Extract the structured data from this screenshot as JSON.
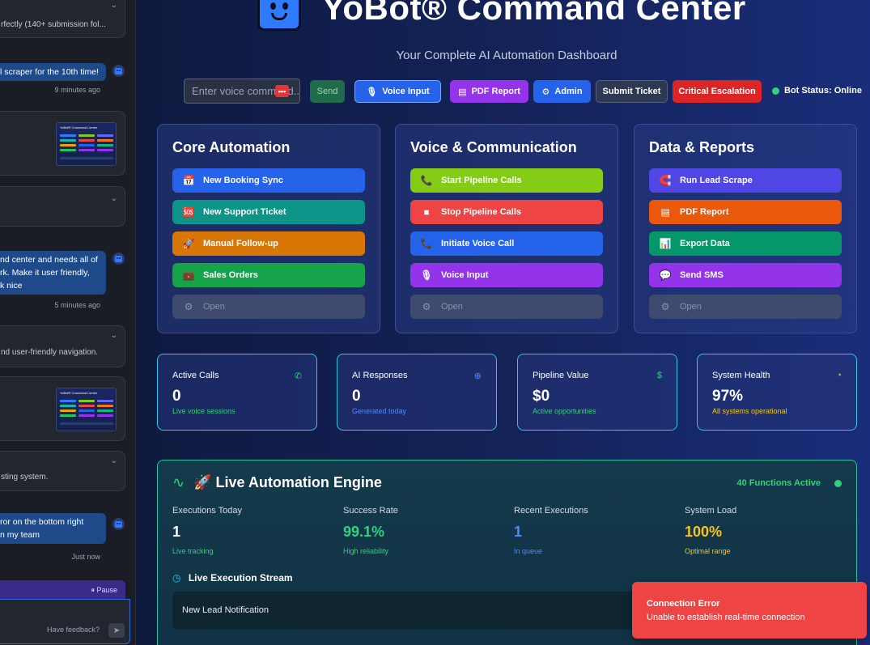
{
  "sidebar": {
    "card1_text": "rfectly (140+ submission fol...",
    "msg1": "l scraper for the 10th time!",
    "msg1_time": "9 minutes ago",
    "msg2_lines": [
      "nd center and needs all of",
      "rk. Make it user friendly,",
      "k nice"
    ],
    "msg2_time": "5 minutes ago",
    "card2_text": "nd user-friendly navigation.",
    "card3_text": "sting system.",
    "msg3_lines": [
      "ror on the bottom right",
      "n my team"
    ],
    "msg3_time": "Just now",
    "thumb_title": "YoBot® Command Center",
    "pause_label": "⏸ Pause",
    "feedback_placeholder": "Have feedback?"
  },
  "header": {
    "title": "YoBot® Command Center",
    "subtitle": "Your Complete AI Automation Dashboard"
  },
  "toolbar": {
    "voice_placeholder": "Enter voice command...",
    "badge": "•••",
    "send": "Send",
    "voice_input": "Voice Input",
    "pdf_report": "PDF Report",
    "admin": "Admin",
    "submit_ticket": "Submit Ticket",
    "critical_escalation": "Critical Escalation",
    "bot_status": "Bot Status: Online"
  },
  "panels": {
    "core": {
      "title": "Core Automation",
      "buttons": [
        "New Booking Sync",
        "New Support Ticket",
        "Manual Follow-up",
        "Sales Orders",
        "Open"
      ]
    },
    "voice": {
      "title": "Voice & Communication",
      "buttons": [
        "Start Pipeline Calls",
        "Stop Pipeline Calls",
        "Initiate Voice Call",
        "Voice Input",
        "Open"
      ]
    },
    "data": {
      "title": "Data & Reports",
      "buttons": [
        "Run Lead Scrape",
        "PDF Report",
        "Export Data",
        "Send SMS",
        "Open"
      ]
    }
  },
  "stats": [
    {
      "label": "Active Calls",
      "value": "0",
      "sub": "Live voice sessions",
      "color": "#34d17a"
    },
    {
      "label": "AI Responses",
      "value": "0",
      "sub": "Generated today",
      "color": "#4f8bff"
    },
    {
      "label": "Pipeline Value",
      "value": "$0",
      "sub": "Active opportunities",
      "color": "#34d17a"
    },
    {
      "label": "System Health",
      "value": "97%",
      "sub": "All systems operational",
      "color": "#f5c518"
    }
  ],
  "engine": {
    "title": "🚀 Live Automation Engine",
    "status": "40 Functions Active",
    "metrics": [
      {
        "label": "Executions Today",
        "value": "1",
        "sub": "Live tracking",
        "color": "#ffffff",
        "sub_color": "#34d17a"
      },
      {
        "label": "Success Rate",
        "value": "99.1%",
        "sub": "High reliability",
        "color": "#34d17a",
        "sub_color": "#34d17a"
      },
      {
        "label": "Recent Executions",
        "value": "1",
        "sub": "In queue",
        "color": "#4f8bff",
        "sub_color": "#4f8bff"
      },
      {
        "label": "System Load",
        "value": "100%",
        "sub": "Optimal range",
        "color": "#f5c518",
        "sub_color": "#f5c518"
      }
    ],
    "stream_title": "Live Execution Stream",
    "stream_item": "New Lead Notification"
  },
  "toast": {
    "title": "Connection Error",
    "message": "Unable to establish real-time connection"
  }
}
